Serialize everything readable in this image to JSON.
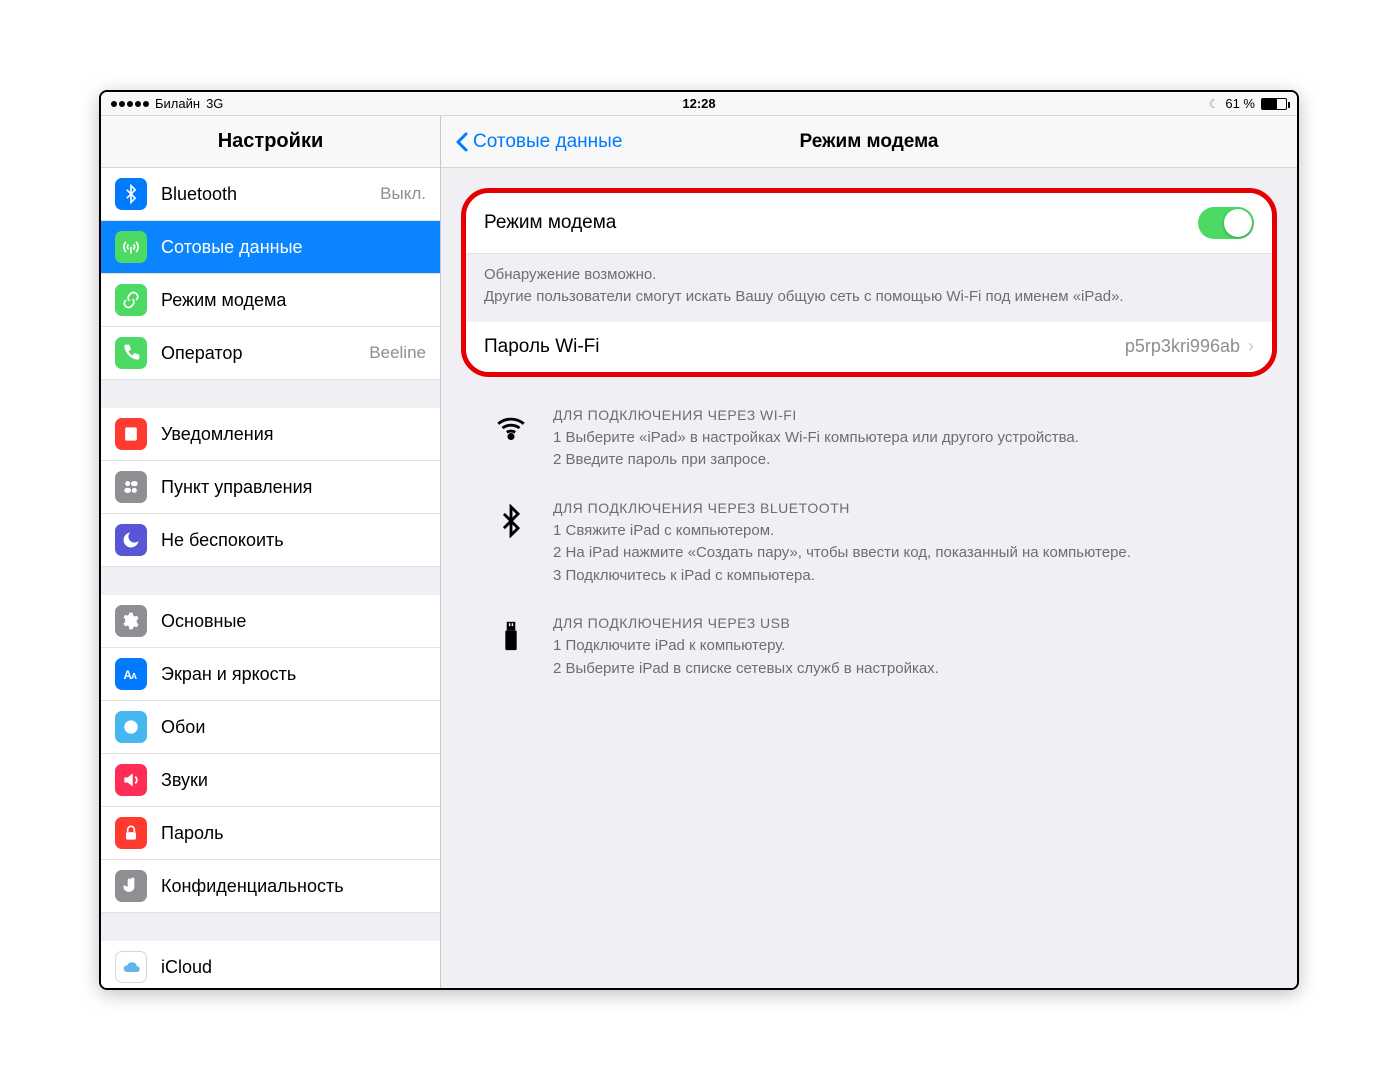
{
  "status": {
    "carrier": "Билайн",
    "network": "3G",
    "time": "12:28",
    "battery_pct": "61 %"
  },
  "sidebar": {
    "title": "Настройки",
    "groups": [
      [
        {
          "label": "Bluetooth",
          "value": "Выкл."
        },
        {
          "label": "Сотовые данные",
          "value": ""
        },
        {
          "label": "Режим модема",
          "value": ""
        },
        {
          "label": "Оператор",
          "value": "Beeline"
        }
      ],
      [
        {
          "label": "Уведомления"
        },
        {
          "label": "Пункт управления"
        },
        {
          "label": "Не беспокоить"
        }
      ],
      [
        {
          "label": "Основные"
        },
        {
          "label": "Экран и яркость"
        },
        {
          "label": "Обои"
        },
        {
          "label": "Звуки"
        },
        {
          "label": "Пароль"
        },
        {
          "label": "Конфиденциальность"
        }
      ],
      [
        {
          "label": "iCloud"
        }
      ]
    ]
  },
  "detail": {
    "back_label": "Сотовые данные",
    "title": "Режим модема",
    "toggle_label": "Режим модема",
    "note_line1": "Обнаружение возможно.",
    "note_line2": "Другие пользователи смогут искать Вашу общую сеть с помощью Wi-Fi под именем «iPad».",
    "password_label": "Пароль Wi-Fi",
    "password_value": "p5rp3kri996ab",
    "wifi": {
      "heading": "ДЛЯ ПОДКЛЮЧЕНИЯ ЧЕРЕЗ WI-FI",
      "s1": "1 Выберите «iPad» в настройках Wi-Fi компьютера или другого устройства.",
      "s2": "2 Введите пароль при запросе."
    },
    "bt": {
      "heading": "ДЛЯ ПОДКЛЮЧЕНИЯ ЧЕРЕЗ BLUETOOTH",
      "s1": "1 Свяжите iPad с компьютером.",
      "s2": "2 На iPad нажмите «Создать пару», чтобы ввести код, показанный на компьютере.",
      "s3": "3 Подключитесь к iPad с компьютера."
    },
    "usb": {
      "heading": "ДЛЯ ПОДКЛЮЧЕНИЯ ЧЕРЕЗ USB",
      "s1": "1 Подключите iPad к компьютеру.",
      "s2": "2 Выберите iPad в списке сетевых служб в настройках."
    }
  }
}
